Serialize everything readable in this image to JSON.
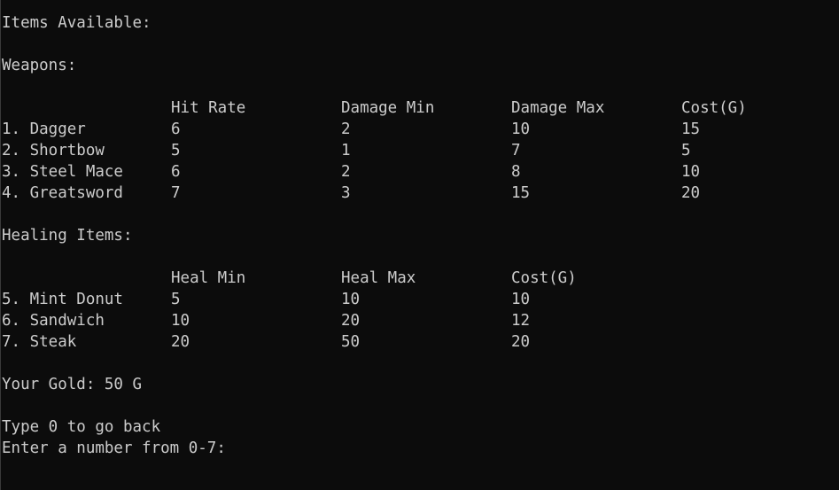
{
  "console": {
    "title_line": "Items Available:",
    "weapons_heading": "Weapons:",
    "weapons_table": {
      "headers": [
        "",
        "Hit Rate",
        "Damage Min",
        "Damage Max",
        "Cost(G)"
      ],
      "rows": [
        [
          "1. Dagger",
          "6",
          "2",
          "10",
          "15"
        ],
        [
          "2. Shortbow",
          "5",
          "1",
          "7",
          "5"
        ],
        [
          "3. Steel Mace",
          "6",
          "2",
          "8",
          "10"
        ],
        [
          "4. Greatsword",
          "7",
          "3",
          "15",
          "20"
        ]
      ]
    },
    "healing_heading": "Healing Items:",
    "healing_table": {
      "headers": [
        "",
        "Heal Min",
        "Heal Max",
        "Cost(G)"
      ],
      "rows": [
        [
          "5. Mint Donut",
          "5",
          "10",
          "10"
        ],
        [
          "6. Sandwich",
          "10",
          "20",
          "12"
        ],
        [
          "7. Steak",
          "20",
          "50",
          "20"
        ]
      ]
    },
    "gold_line": "Your Gold: 50 G",
    "back_line": "Type 0 to go back",
    "prompt_line": "Enter a number from 0-7:"
  }
}
